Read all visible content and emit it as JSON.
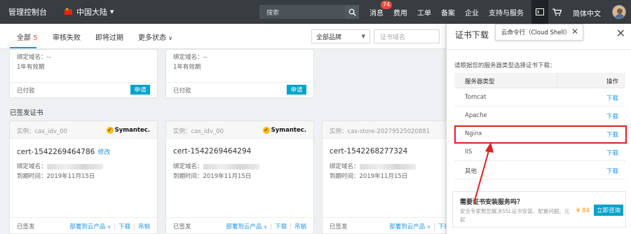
{
  "topbar": {
    "brand": "管理控制台",
    "region": "中国大陆",
    "search_placeholder": "搜索",
    "nav": [
      {
        "label": "消息",
        "badge": "74"
      },
      {
        "label": "费用"
      },
      {
        "label": "工单"
      },
      {
        "label": "备案"
      },
      {
        "label": "企业"
      },
      {
        "label": "支持与服务"
      }
    ],
    "language": "简体中文"
  },
  "tabs": {
    "all_label": "全部",
    "all_count": "5",
    "review_failed": "审核失败",
    "expiring": "即将过期",
    "more_status": "更多状态"
  },
  "filters": {
    "brand_select": "全部品牌",
    "domain_placeholder": "证书域名"
  },
  "top_cards": [
    {
      "bind_domain": "绑定域名：--",
      "validity": "1年有效期",
      "status": "已付款",
      "apply": "申请"
    },
    {
      "bind_domain": "绑定域名：--",
      "validity": "1年有效期",
      "status": "已付款",
      "apply": "申请"
    }
  ],
  "section_title": "已签发证书",
  "certs": [
    {
      "instance": "实例：cas_idv_00",
      "brand": "Symantec.",
      "name": "cert-1542269464786",
      "edit": "修改",
      "bind_label": "绑定域名：",
      "expire_label": "到期时间：",
      "expire_value": "2019年11月15日",
      "status": "已签发",
      "deploy": "部署到云产品",
      "download": "下载",
      "revoke": "吊销"
    },
    {
      "instance": "实例：cas_idv_00",
      "brand": "Symantec.",
      "name": "cert-1542269464294",
      "edit": "",
      "bind_label": "绑定域名：",
      "expire_label": "到期时间：",
      "expire_value": "2019年11月15日",
      "status": "已签发",
      "deploy": "部署到云产品",
      "download": "下载",
      "revoke": "吊销"
    },
    {
      "instance": "实例：cas-store-20279525020881",
      "brand": "",
      "name": "cert-1542268277324",
      "edit": "",
      "bind_label": "绑定域名：",
      "expire_label": "到期时间：",
      "expire_value": "2019年11月15日",
      "status": "已签发",
      "deploy": "部署到云产品",
      "download": "下载",
      "revoke": ""
    }
  ],
  "panel": {
    "title": "证书下载",
    "tooltip": "云命令行（Cloud Shell）",
    "description": "请根据您的服务器类型选择证书下载：",
    "col_server": "服务器类型",
    "col_action": "操作",
    "rows": [
      {
        "server": "Tomcat",
        "action": "下载"
      },
      {
        "server": "Apache",
        "action": "下载"
      },
      {
        "server": "Nginx",
        "action": "下载"
      },
      {
        "server": "IIS",
        "action": "下载"
      },
      {
        "server": "其他",
        "action": "下载"
      }
    ],
    "promo_title": "需要证书安装服务吗？",
    "promo_desc": "安全专家帮您解决SSL证书安装、配置问题。元起",
    "promo_price": "¥ 84",
    "promo_button": "立即咨询"
  },
  "colors": {
    "topbar_bg": "#373d41",
    "accent_blue": "#2496e6",
    "button_teal": "#00a2ca",
    "highlight_red": "#e02020",
    "badge_red": "#e74c3c"
  }
}
